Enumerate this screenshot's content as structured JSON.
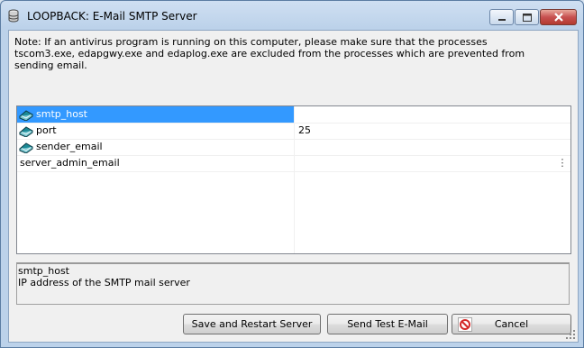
{
  "window": {
    "title": "LOOPBACK: E-Mail SMTP Server"
  },
  "note": {
    "line1": "Note: If an antivirus program is running on this computer, please make sure that the processes",
    "line2": "tscom3.exe, edapgwy.exe and edaplog.exe are excluded from the processes which are prevented from",
    "line3": "sending email."
  },
  "properties": [
    {
      "name": "smtp_host",
      "value": ""
    },
    {
      "name": "port",
      "value": "25"
    },
    {
      "name": "sender_email",
      "value": ""
    },
    {
      "name": "server_admin_email",
      "value": ""
    }
  ],
  "description": {
    "title": "smtp_host",
    "text": "IP address of the SMTP mail server"
  },
  "buttons": {
    "save": "Save and Restart Server",
    "test": "Send Test E-Mail",
    "cancel": "Cancel"
  },
  "colors": {
    "selection": "#3399ff",
    "close_button": "#c75050"
  }
}
